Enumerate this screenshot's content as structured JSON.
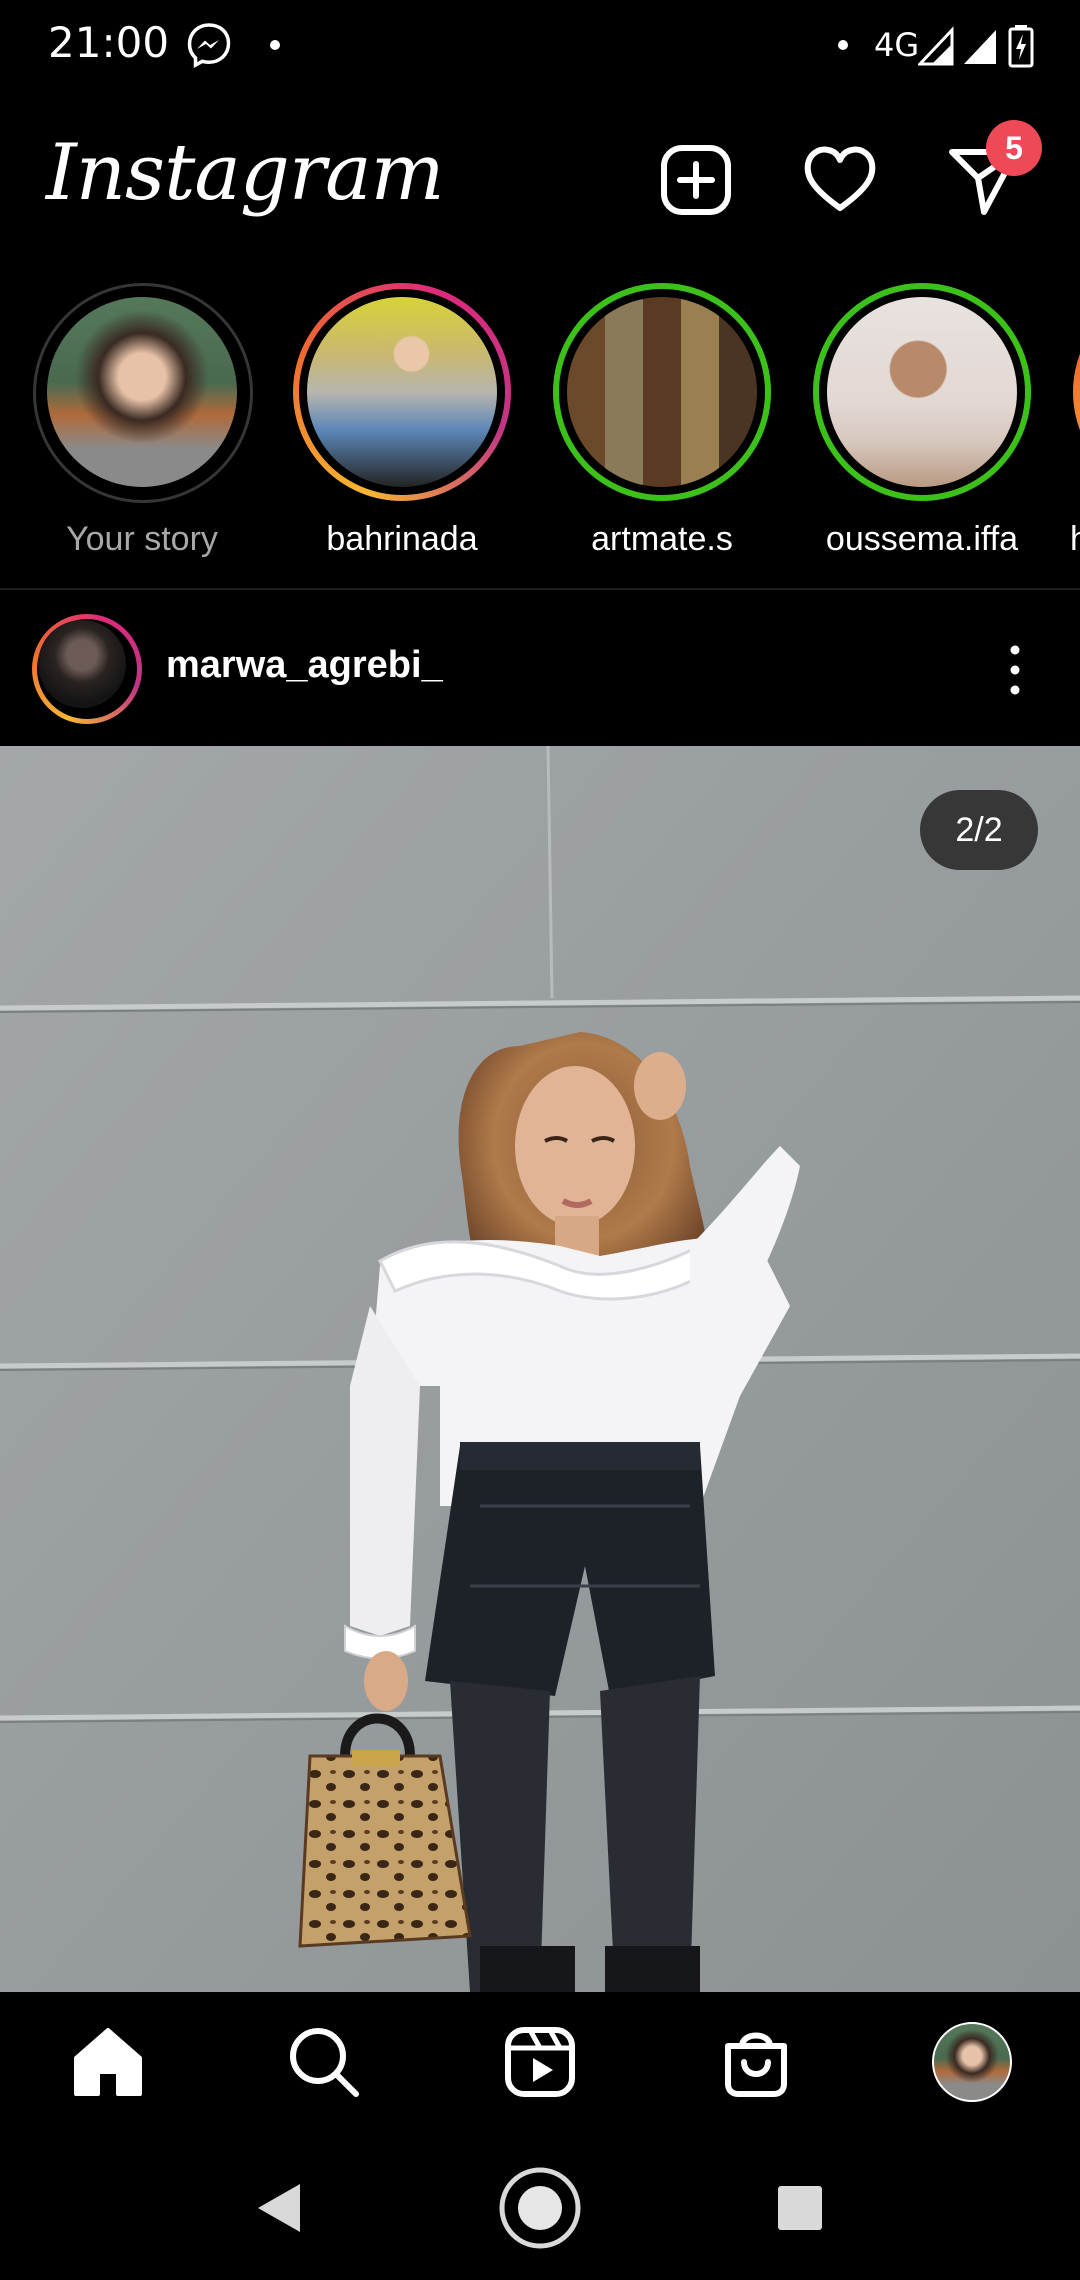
{
  "status_bar": {
    "time": "21:00",
    "network": "4G",
    "icons": [
      "messenger-icon",
      "dot-icon",
      "signal-icon",
      "battery-charging-icon"
    ]
  },
  "header": {
    "logo": "Instagram",
    "actions": [
      "new-post-icon",
      "heart-icon",
      "direct-message-icon"
    ],
    "dm_badge": "5"
  },
  "stories": [
    {
      "name": "Your story",
      "ring": "seen"
    },
    {
      "name": "bahrinada",
      "ring": "gradient"
    },
    {
      "name": "artmate.s",
      "ring": "close-friends"
    },
    {
      "name": "oussema.iffa",
      "ring": "close-friends"
    },
    {
      "name": "h",
      "ring": "gradient"
    }
  ],
  "post": {
    "username": "marwa_agrebi_",
    "counter": "2/2"
  },
  "bottom_nav": [
    "home-icon",
    "search-icon",
    "reels-icon",
    "shop-icon",
    "profile-avatar"
  ],
  "colors": {
    "background": "#000000",
    "badge": "#ed4956",
    "close_friends_ring": "#3cc11a",
    "muted_text": "#a8a8a8"
  }
}
